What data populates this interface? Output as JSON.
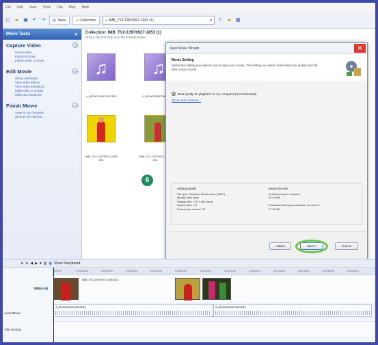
{
  "menu": [
    "File",
    "Edit",
    "View",
    "Tools",
    "Clip",
    "Play",
    "Help"
  ],
  "toolbar": {
    "tasks_label": "Tasks",
    "collections_label": "Collections",
    "address": "IMB_TV2-13970927-1853 (1)"
  },
  "sidebar": {
    "title": "Movie Tasks",
    "sections": [
      {
        "heading": "Capture Video",
        "links": [
          "Import video",
          "Import pictures",
          "Import audio or music"
        ]
      },
      {
        "heading": "Edit Movie",
        "links": [
          "Show collections",
          "View video effects",
          "View video transitions",
          "Make titles or credits",
          "Make an AutoMovie"
        ]
      },
      {
        "heading": "Finish Movie",
        "links": [
          "Save to my computer",
          "Send to DV camera"
        ]
      }
    ]
  },
  "collection": {
    "title": "Collection: IMB_TV2-13970927-1853 (1)",
    "subtitle": "Drag a clip and drop it on the timeline below.",
    "items": [
      {
        "label": "4_801987409673422159",
        "kind": "audio"
      },
      {
        "label": "4_801987409673422",
        "kind": "audio"
      },
      {
        "label": "IMB_TV2-13970927-1853 002",
        "kind": "video"
      },
      {
        "label": "IMB_TV2-13970927-1853 001",
        "kind": "video"
      }
    ]
  },
  "dialog": {
    "title": "Save Movie Wizard",
    "close": "✕",
    "header_title": "Movie Setting",
    "header_desc": "Select the setting you want to use to save your movie. The setting you select determines the quality and file size of your movie.",
    "option_label": "Best quality for playback on my computer (recommended)",
    "more_link": "Show more choices...",
    "details": {
      "left_head": "Setting details",
      "left_lines": [
        "File type: Windows Media Video (WMV)",
        "Bit rate: 896 Kbps",
        "Display size: 720 x 480 pixels",
        "Aspect ratio: 4:3",
        "Frames per second: 30"
      ],
      "right_head": "Movie file size",
      "right_lines": [
        "Estimated space required:",
        "32.54 MB",
        "",
        "Estimated disk space available on drive C:",
        "17.68 GB"
      ]
    },
    "buttons": {
      "back": "< Back",
      "next": "Next >",
      "cancel": "Cancel"
    }
  },
  "step_badge": "6",
  "timeline": {
    "storyboard_label": "Show Storyboard",
    "tracks": {
      "video": "Video",
      "audio": "Audio/Music",
      "title": "Title Overlay"
    },
    "video_clip_label": "IMB_TV2-13970927-1853 001",
    "audio_clip_1": "4_801987409673422159",
    "audio_clip_2": "4_801987409673422159",
    "ruler": [
      "0:00:00",
      "0:00:10.00",
      "0:00:20.00",
      "0:00:30.00",
      "0:00:40.00",
      "0:00:50.00",
      "0:01:00.00",
      "0:01:10.00",
      "0:01:20.00",
      "0:01:30.00",
      "0:01:40.00",
      "0:01:50.00",
      "0:02:00.00"
    ]
  },
  "colors": {
    "accent": "#2f63b5",
    "ring": "#6fc24a",
    "badge": "#1f8a5a",
    "close": "#d93a2f"
  }
}
